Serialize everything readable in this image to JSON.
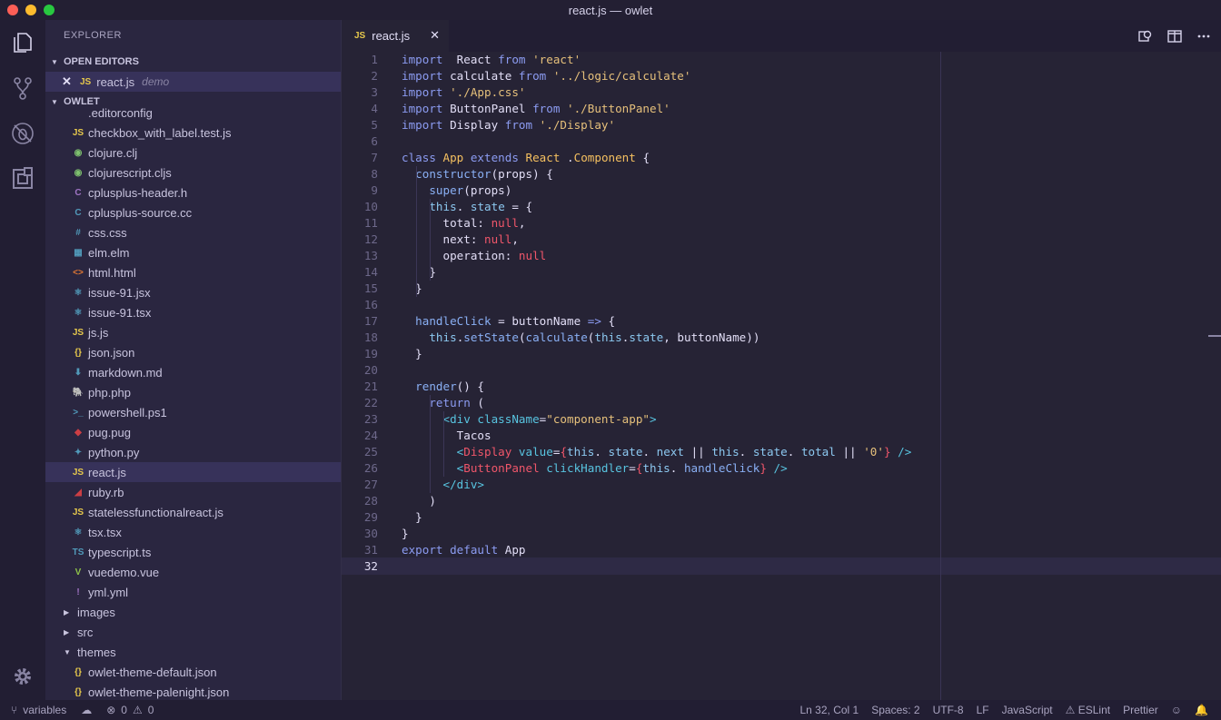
{
  "window": {
    "title": "react.js — owlet"
  },
  "activity_bar": {
    "icons": [
      "files-icon",
      "source-control-icon",
      "debug-icon",
      "extensions-icon",
      "settings-gear-icon"
    ]
  },
  "explorer": {
    "title": "EXPLORER",
    "open_editors": {
      "heading": "OPEN EDITORS",
      "items": [
        {
          "name": "react.js",
          "badge": "JS",
          "group": "demo"
        }
      ]
    },
    "workspace": {
      "heading": "OWLET",
      "items": [
        {
          "name": ".editorconfig",
          "badge": "",
          "color": "#a9a4c0"
        },
        {
          "name": "checkbox_with_label.test.js",
          "badge": "JS",
          "color": "#e6c84c"
        },
        {
          "name": "clojure.clj",
          "badge": "◉",
          "color": "#7ec16e"
        },
        {
          "name": "clojurescript.cljs",
          "badge": "◉",
          "color": "#7ec16e"
        },
        {
          "name": "cplusplus-header.h",
          "badge": "C",
          "color": "#a074c4"
        },
        {
          "name": "cplusplus-source.cc",
          "badge": "C",
          "color": "#519aba"
        },
        {
          "name": "css.css",
          "badge": "#",
          "color": "#519aba"
        },
        {
          "name": "elm.elm",
          "badge": "▦",
          "color": "#519aba"
        },
        {
          "name": "html.html",
          "badge": "<>",
          "color": "#e37933"
        },
        {
          "name": "issue-91.jsx",
          "badge": "⚛",
          "color": "#519aba"
        },
        {
          "name": "issue-91.tsx",
          "badge": "⚛",
          "color": "#519aba"
        },
        {
          "name": "js.js",
          "badge": "JS",
          "color": "#e6c84c"
        },
        {
          "name": "json.json",
          "badge": "{}",
          "color": "#e6c84c"
        },
        {
          "name": "markdown.md",
          "badge": "⬇",
          "color": "#519aba"
        },
        {
          "name": "php.php",
          "badge": "🐘",
          "color": "#a074c4"
        },
        {
          "name": "powershell.ps1",
          "badge": ">_",
          "color": "#519aba"
        },
        {
          "name": "pug.pug",
          "badge": "◆",
          "color": "#cc3e44"
        },
        {
          "name": "python.py",
          "badge": "✦",
          "color": "#519aba"
        },
        {
          "name": "react.js",
          "badge": "JS",
          "color": "#e6c84c",
          "selected": true
        },
        {
          "name": "ruby.rb",
          "badge": "◢",
          "color": "#cc3e44"
        },
        {
          "name": "statelessfunctionalreact.js",
          "badge": "JS",
          "color": "#e6c84c"
        },
        {
          "name": "tsx.tsx",
          "badge": "⚛",
          "color": "#519aba"
        },
        {
          "name": "typescript.ts",
          "badge": "TS",
          "color": "#519aba"
        },
        {
          "name": "vuedemo.vue",
          "badge": "V",
          "color": "#8dc149"
        },
        {
          "name": "yml.yml",
          "badge": "!",
          "color": "#a074c4"
        },
        {
          "name": "images",
          "folder": true,
          "open": false
        },
        {
          "name": "src",
          "folder": true,
          "open": false
        },
        {
          "name": "themes",
          "folder": true,
          "open": true
        },
        {
          "name": "owlet-theme-default.json",
          "badge": "{}",
          "color": "#e6c84c"
        },
        {
          "name": "owlet-theme-palenight.json",
          "badge": "{}",
          "color": "#e6c84c"
        }
      ]
    }
  },
  "tab": {
    "label": "react.js",
    "badge": "JS"
  },
  "editor": {
    "current_line": 32,
    "lines": [
      [
        [
          "k",
          "import"
        ],
        [
          "",
          "  React "
        ],
        [
          "k",
          "from"
        ],
        [
          "s",
          " 'react'"
        ]
      ],
      [
        [
          "k",
          "import"
        ],
        [
          "",
          " calculate "
        ],
        [
          "k",
          "from"
        ],
        [
          "s",
          " '../logic/calculate'"
        ]
      ],
      [
        [
          "k",
          "import"
        ],
        [
          "s",
          " './App.css'"
        ]
      ],
      [
        [
          "k",
          "import"
        ],
        [
          "",
          " ButtonPanel "
        ],
        [
          "k",
          "from"
        ],
        [
          "s",
          " './ButtonPanel'"
        ]
      ],
      [
        [
          "k",
          "import"
        ],
        [
          "",
          " Display "
        ],
        [
          "k",
          "from"
        ],
        [
          "s",
          " './Display'"
        ]
      ],
      [],
      [
        [
          "k",
          "class"
        ],
        [
          "c",
          " App"
        ],
        [
          "k",
          " extends"
        ],
        [
          "c",
          " React"
        ],
        [
          "",
          " ."
        ],
        [
          "c",
          "Component"
        ],
        [
          "",
          " {"
        ]
      ],
      [
        [
          "",
          "  "
        ],
        [
          "f",
          "constructor"
        ],
        [
          "",
          "(props) {"
        ]
      ],
      [
        [
          "",
          "    "
        ],
        [
          "f",
          "super"
        ],
        [
          "",
          "(props)"
        ]
      ],
      [
        [
          "",
          "    "
        ],
        [
          "p",
          "this"
        ],
        [
          "",
          ". "
        ],
        [
          "p",
          "state"
        ],
        [
          "",
          " = {"
        ]
      ],
      [
        [
          "",
          "      total: "
        ],
        [
          "n",
          "null"
        ],
        [
          "",
          ","
        ]
      ],
      [
        [
          "",
          "      next: "
        ],
        [
          "n",
          "null"
        ],
        [
          "",
          ","
        ]
      ],
      [
        [
          "",
          "      operation: "
        ],
        [
          "n",
          "null"
        ]
      ],
      [
        [
          "",
          "    }"
        ]
      ],
      [
        [
          "",
          "  }"
        ]
      ],
      [],
      [
        [
          "",
          "  "
        ],
        [
          "f",
          "handleClick"
        ],
        [
          "",
          " = buttonName "
        ],
        [
          "k",
          "=>"
        ],
        [
          "",
          " {"
        ]
      ],
      [
        [
          "",
          "    "
        ],
        [
          "p",
          "this"
        ],
        [
          "",
          "."
        ],
        [
          "f",
          "setState"
        ],
        [
          "",
          "("
        ],
        [
          "f",
          "calculate"
        ],
        [
          "",
          "("
        ],
        [
          "p",
          "this"
        ],
        [
          "",
          "."
        ],
        [
          "p",
          "state"
        ],
        [
          "",
          ", buttonName))"
        ]
      ],
      [
        [
          "",
          "  }"
        ]
      ],
      [],
      [
        [
          "",
          "  "
        ],
        [
          "f",
          "render"
        ],
        [
          "",
          "() {"
        ]
      ],
      [
        [
          "",
          "    "
        ],
        [
          "k",
          "return"
        ],
        [
          "",
          " ("
        ]
      ],
      [
        [
          "",
          "      "
        ],
        [
          "t",
          "<div"
        ],
        [
          "t",
          " className"
        ],
        [
          "",
          "="
        ],
        [
          "s",
          "\"component-app\""
        ],
        [
          "t",
          ">"
        ]
      ],
      [
        [
          "",
          "        Tacos"
        ]
      ],
      [
        [
          "",
          "        "
        ],
        [
          "t",
          "<"
        ],
        [
          "r",
          "Display"
        ],
        [
          "t",
          " value"
        ],
        [
          "",
          "="
        ],
        [
          "r",
          "{"
        ],
        [
          "p",
          "this"
        ],
        [
          "",
          ". "
        ],
        [
          "p",
          "state"
        ],
        [
          "",
          ". "
        ],
        [
          "p",
          "next"
        ],
        [
          "",
          " || "
        ],
        [
          "p",
          "this"
        ],
        [
          "",
          ". "
        ],
        [
          "p",
          "state"
        ],
        [
          "",
          ". "
        ],
        [
          "p",
          "total"
        ],
        [
          "",
          " || "
        ],
        [
          "s",
          "'0'"
        ],
        [
          "r",
          "}"
        ],
        [
          "t",
          " />"
        ]
      ],
      [
        [
          "",
          "        "
        ],
        [
          "t",
          "<"
        ],
        [
          "r",
          "ButtonPanel"
        ],
        [
          "t",
          " clickHandler"
        ],
        [
          "",
          "="
        ],
        [
          "r",
          "{"
        ],
        [
          "p",
          "this"
        ],
        [
          "",
          ". "
        ],
        [
          "f",
          "handleClick"
        ],
        [
          "r",
          "}"
        ],
        [
          "t",
          " />"
        ]
      ],
      [
        [
          "",
          "      "
        ],
        [
          "t",
          "</div>"
        ]
      ],
      [
        [
          "",
          "    )"
        ]
      ],
      [
        [
          "",
          "  }"
        ]
      ],
      [
        [
          "",
          "}"
        ]
      ],
      [
        [
          "k",
          "export"
        ],
        [
          "k",
          " default"
        ],
        [
          "",
          " App"
        ]
      ],
      []
    ]
  },
  "status": {
    "branch": "variables",
    "errors": "0",
    "warnings": "0",
    "position": "Ln 32, Col 1",
    "spaces": "Spaces: 2",
    "encoding": "UTF-8",
    "eol": "LF",
    "language": "JavaScript",
    "eslint": "ESLint",
    "prettier": "Prettier"
  }
}
